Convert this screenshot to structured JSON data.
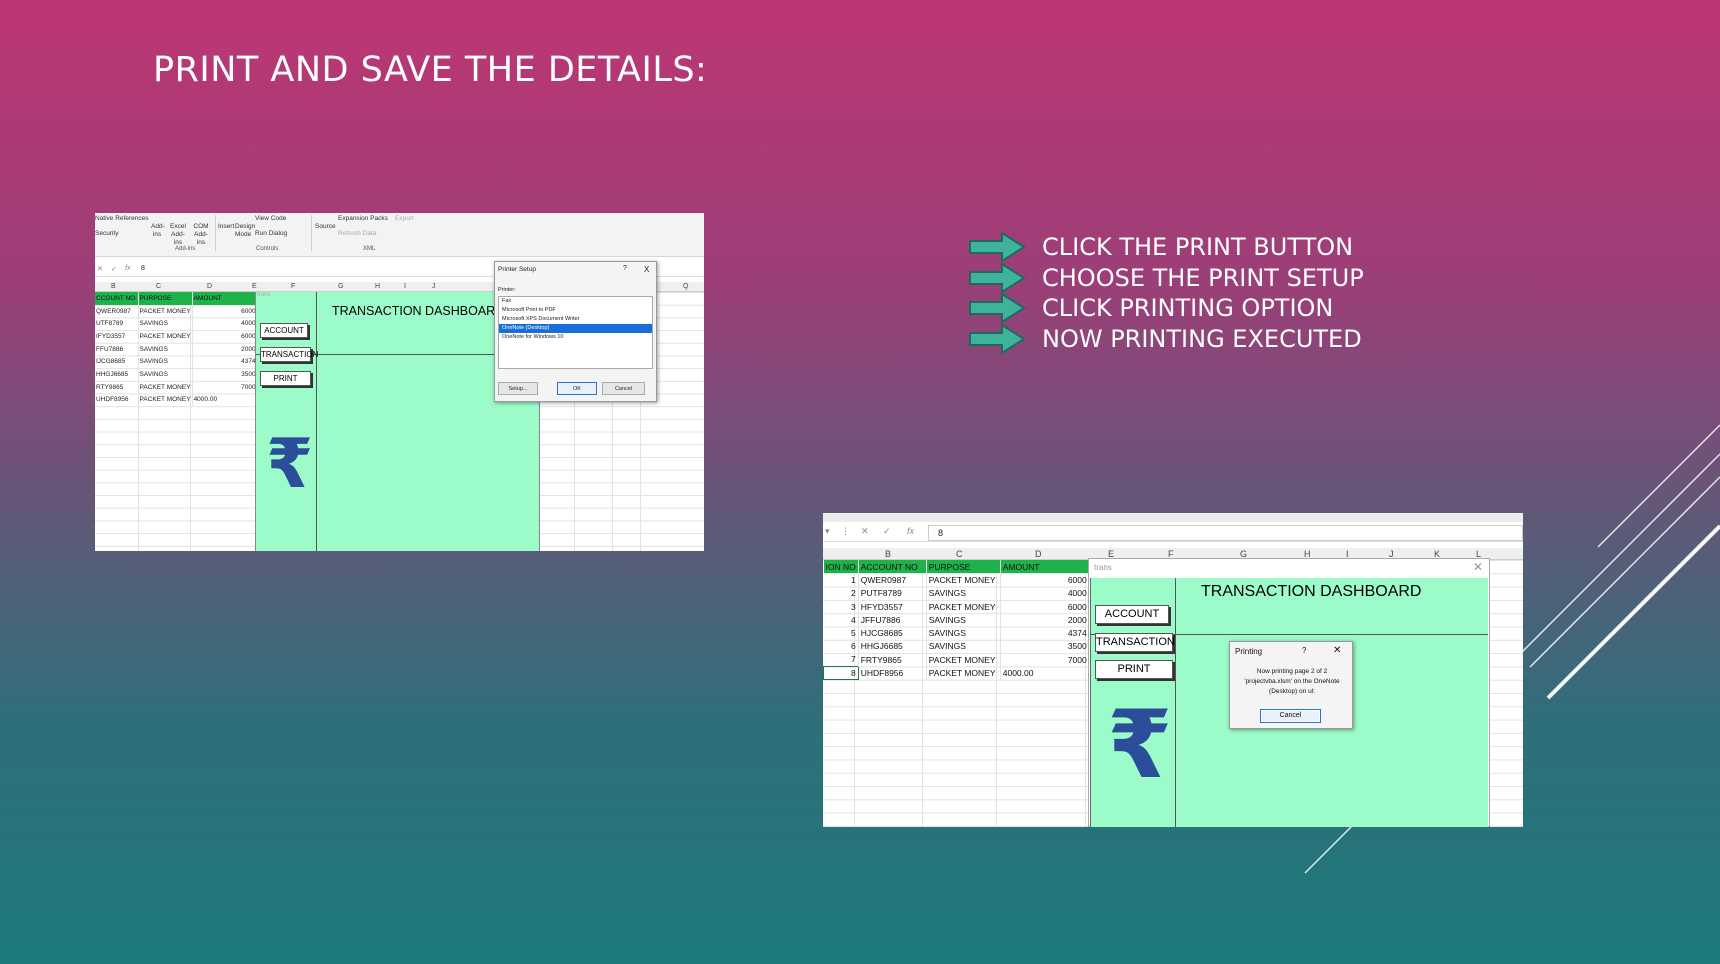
{
  "slide": {
    "title": "PRINT AND SAVE THE DETAILS:",
    "steps": [
      "CLICK THE PRINT BUTTON",
      "CHOOSE THE PRINT SETUP",
      "CLICK PRINTING OPTION",
      "NOW PRINTING EXECUTED"
    ],
    "colors": {
      "arrow": "#3fb39a",
      "arrow_outline": "#1f6a60",
      "panel_green": "#9bfcca",
      "header_green": "#1db34a",
      "rupee_blue": "#2c4d9a"
    }
  },
  "shot1": {
    "ribbon": {
      "native_refs": "Native References",
      "security": "Security",
      "addins": "Add-ins",
      "excel_addins": "Excel Add-ins",
      "com_addins": "COM Add-ins",
      "insert": "Insert",
      "design_mode": "Design Mode",
      "view_code": "View Code",
      "run_dialog": "Run Dialog",
      "source": "Source",
      "expansion_packs": "Expansion Packs",
      "refresh_data": "Refresh Data",
      "export": "Export",
      "group_addins": "Add-ins",
      "group_controls": "Controls",
      "group_xml": "XML"
    },
    "formula_value": "8",
    "columns": [
      "B",
      "C",
      "D",
      "E",
      "F",
      "G",
      "H",
      "I",
      "J",
      "Q"
    ],
    "headers": [
      "CCOUNT NO",
      "PURPOSE",
      "AMOUNT"
    ],
    "rows": [
      [
        "QWER0987",
        "PACKET MONEY",
        "6000"
      ],
      [
        "UTF8789",
        "SAVINGS",
        "4000"
      ],
      [
        "IFYD3557",
        "PACKET MONEY",
        "6000"
      ],
      [
        "FFU7886",
        "SAVINGS",
        "2000"
      ],
      [
        "IJCG8685",
        "SAVINGS",
        "4374"
      ],
      [
        "HHGJ6685",
        "SAVINGS",
        "3500"
      ],
      [
        "RTY9865",
        "PACKET MONEY",
        "7000"
      ],
      [
        "UHDF8956",
        "PACKET MONEY",
        "4000.00"
      ]
    ],
    "form_caption": "trans",
    "dashboard_title": "TRANSACTION DASHBOARD",
    "buttons": [
      "ACCOUNT",
      "TRANSACTION",
      "PRINT"
    ],
    "rupee": "₹",
    "printer_dialog": {
      "title": "Printer Setup",
      "help": "?",
      "close": "X",
      "printer_label": "Printer:",
      "printers": [
        "Fax",
        "Microsoft Print to PDF",
        "Microsoft XPS Document Writer",
        "OneNote (Desktop)",
        "OneNote for Windows 10"
      ],
      "selected": "OneNote (Desktop)",
      "setup": "Setup...",
      "ok": "OK",
      "cancel": "Cancel"
    }
  },
  "shot2": {
    "formula_value": "8",
    "columns": [
      "B",
      "C",
      "D",
      "E",
      "F",
      "G",
      "H",
      "I",
      "J",
      "K",
      "L"
    ],
    "headers": [
      "ION NO",
      "ACCOUNT NO",
      "PURPOSE",
      "AMOUNT"
    ],
    "rows": [
      [
        "1",
        "QWER0987",
        "PACKET MONEY",
        "6000"
      ],
      [
        "2",
        "PUTF8789",
        "SAVINGS",
        "4000"
      ],
      [
        "3",
        "HFYD3557",
        "PACKET MONEY",
        "6000"
      ],
      [
        "4",
        "JFFU7886",
        "SAVINGS",
        "2000"
      ],
      [
        "5",
        "HJCG8685",
        "SAVINGS",
        "4374"
      ],
      [
        "6",
        "HHGJ6685",
        "SAVINGS",
        "3500"
      ],
      [
        "7",
        "FRTY9865",
        "PACKET MONEY",
        "7000"
      ],
      [
        "8",
        "UHDF8956",
        "PACKET MONEY",
        "4000.00"
      ]
    ],
    "form_caption": "trans",
    "dashboard_title": "TRANSACTION DASHBOARD",
    "buttons": [
      "ACCOUNT",
      "TRANSACTION",
      "PRINT"
    ],
    "rupee": "₹",
    "printing_dialog": {
      "title": "Printing",
      "help": "?",
      "close": "✕",
      "message": "Now printing page 2 of 2 'projectvba.xlsm' on the OneNote (Desktop) on ul:",
      "cancel": "Cancel"
    }
  }
}
